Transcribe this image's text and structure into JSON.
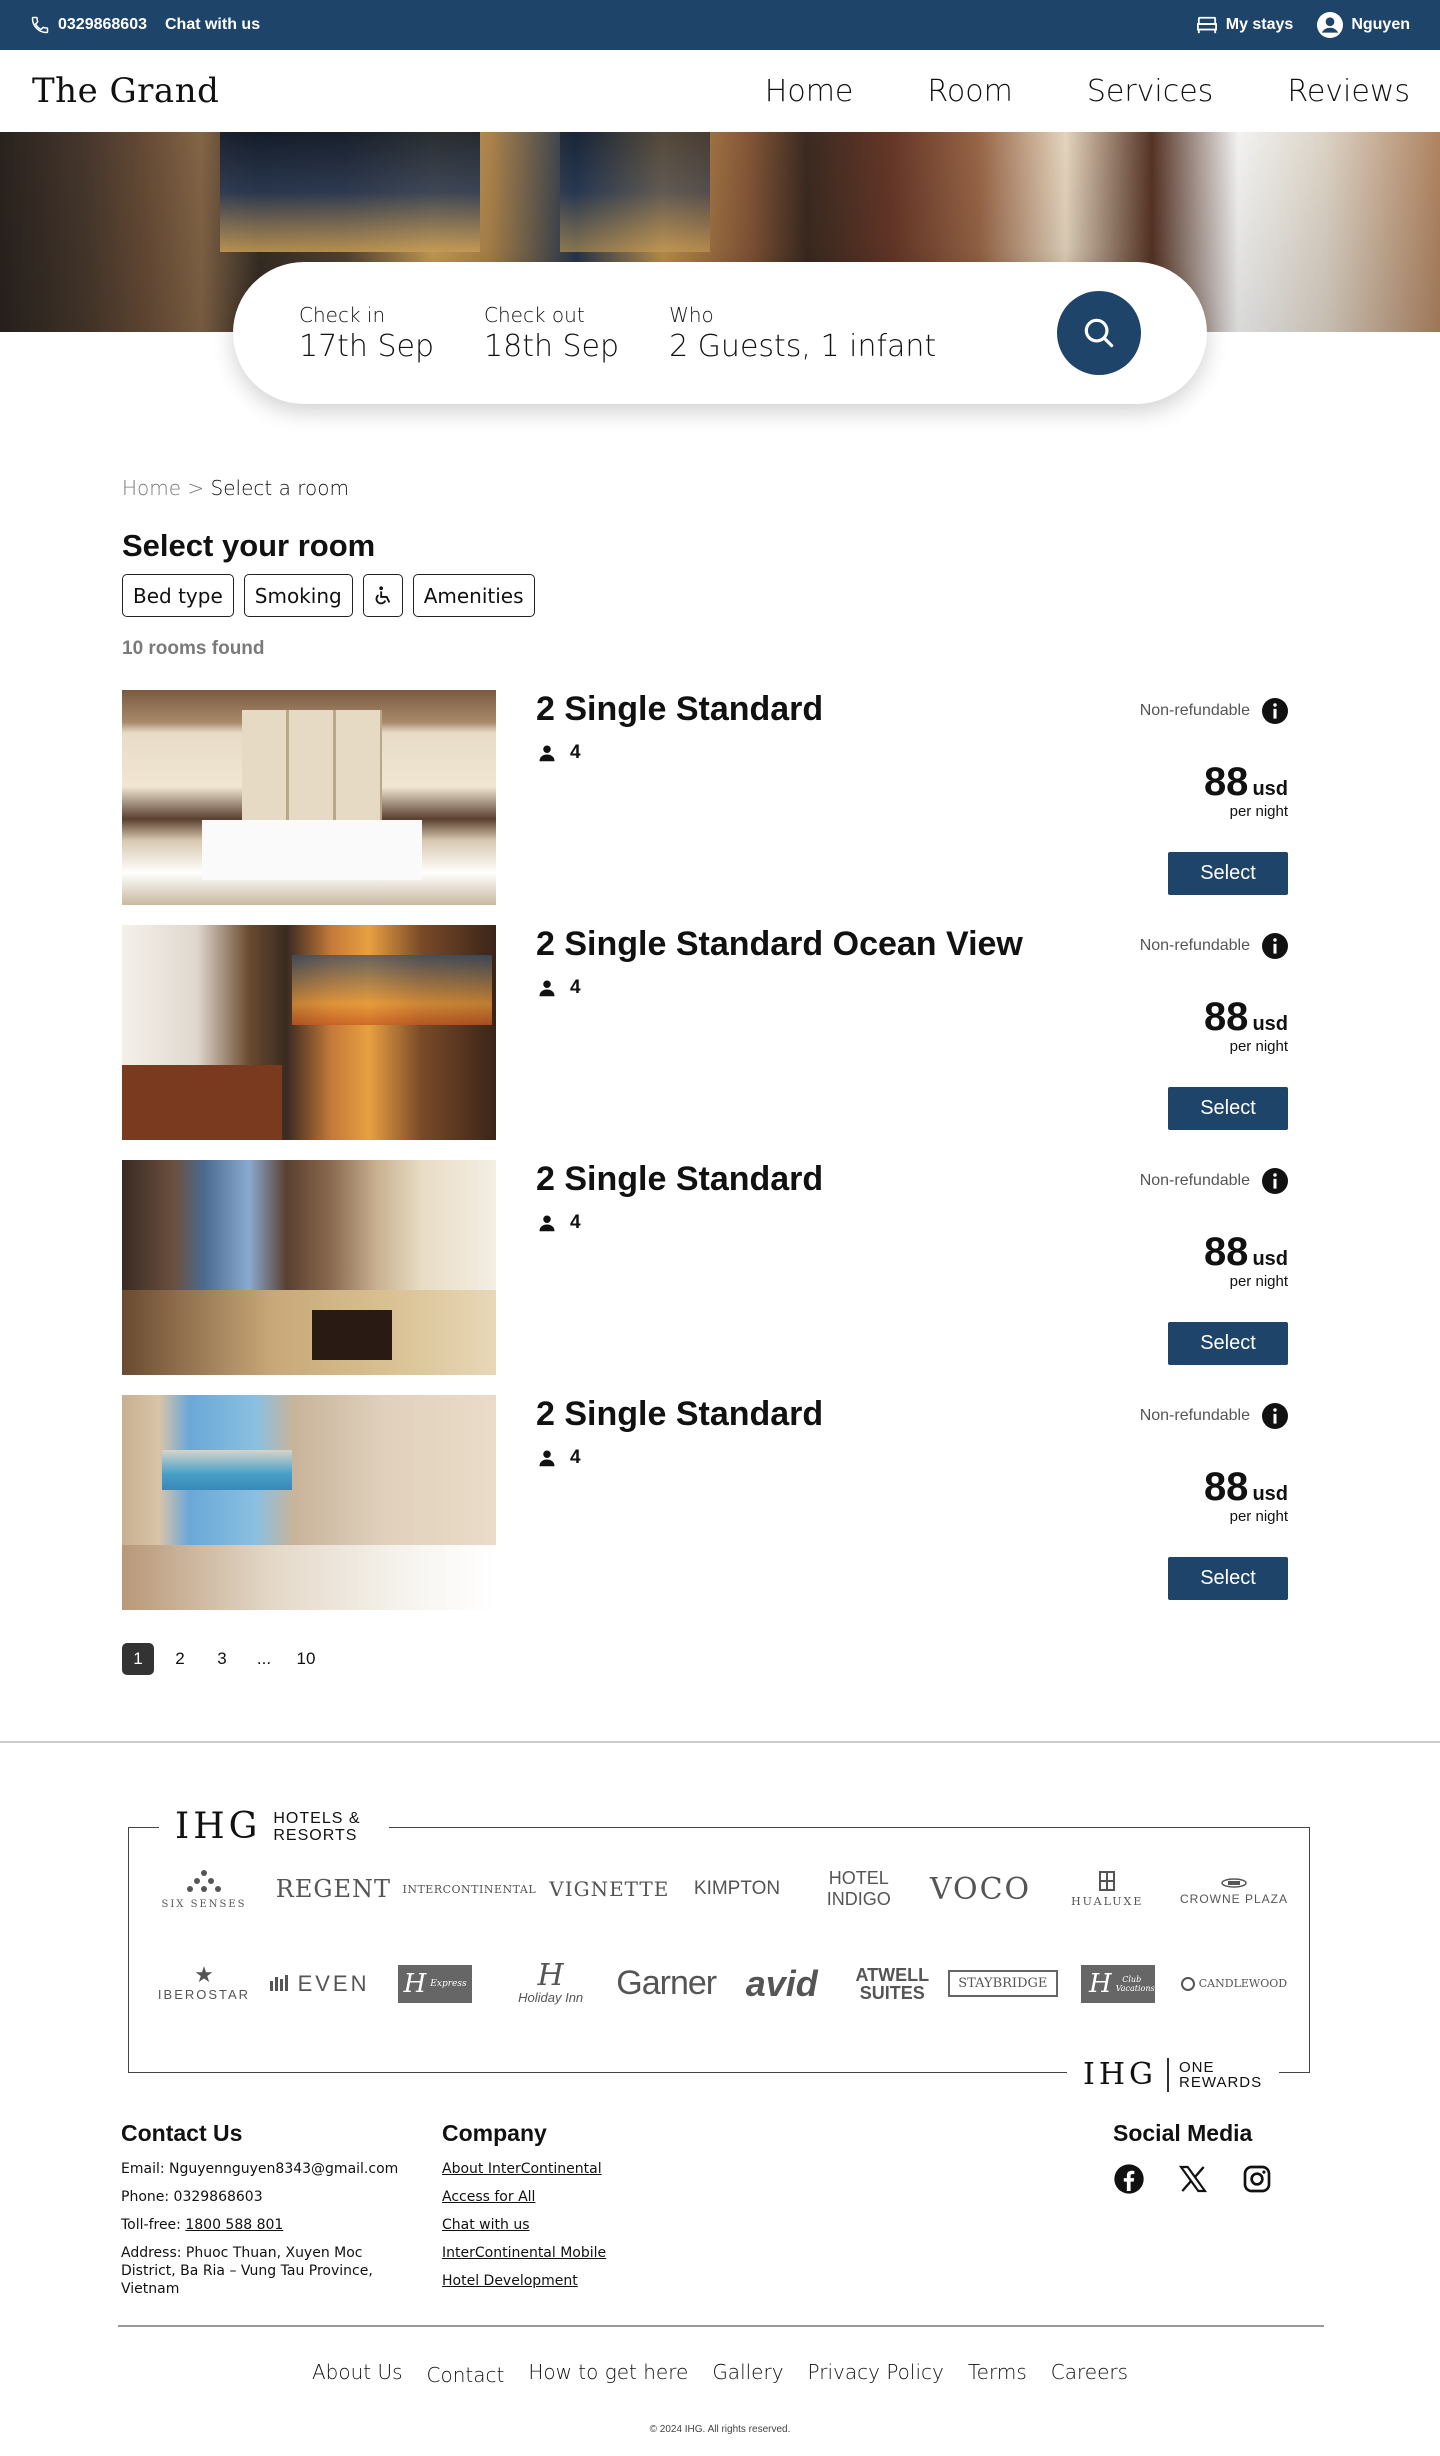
{
  "topbar": {
    "phone": "0329868603",
    "chat": "Chat with us",
    "my_stays": "My stays",
    "user": "Nguyen"
  },
  "nav": {
    "logo": "The Grand",
    "links": [
      "Home",
      "Room",
      "Services",
      "Reviews"
    ]
  },
  "search": {
    "check_in_label": "Check in",
    "check_in_value": "17th Sep",
    "check_out_label": "Check out",
    "check_out_value": "18th Sep",
    "who_label": "Who",
    "who_value": "2 Guests, 1 infant"
  },
  "breadcrumb": {
    "home": "Home",
    "sep": " > ",
    "current": "Select a room"
  },
  "main": {
    "title": "Select your room",
    "filters": [
      "Bed type",
      "Smoking",
      "Amenities"
    ],
    "rooms_found": "10 rooms found"
  },
  "rooms": [
    {
      "name": "2 Single Standard",
      "guests": "4",
      "policy": "Non-refundable",
      "price": "88",
      "currency": "usd",
      "per": "per night",
      "select": "Select"
    },
    {
      "name": "2 Single Standard Ocean View",
      "guests": "4",
      "policy": "Non-refundable",
      "price": "88",
      "currency": "usd",
      "per": "per night",
      "select": "Select"
    },
    {
      "name": "2 Single Standard",
      "guests": "4",
      "policy": "Non-refundable",
      "price": "88",
      "currency": "usd",
      "per": "per night",
      "select": "Select"
    },
    {
      "name": "2 Single Standard",
      "guests": "4",
      "policy": "Non-refundable",
      "price": "88",
      "currency": "usd",
      "per": "per night",
      "select": "Select"
    }
  ],
  "pagination": [
    "1",
    "2",
    "3",
    "...",
    "10"
  ],
  "brands": {
    "ihg": "IHG",
    "hotels_resorts": "HOTELS & RESORTS",
    "ihg_footer": "IHG",
    "one_rewards": "ONE REWARDS",
    "row1": [
      "SIX SENSES",
      "REGENT",
      "INTERCONTINENTAL",
      "VIGNETTE",
      "KIMPTON",
      "HOTEL INDIGO",
      "VOCO",
      "HUALUXE",
      "CROWNE PLAZA"
    ],
    "row2": [
      "IBEROSTAR",
      "EVEN",
      "Express",
      "Holiday Inn",
      "Garner",
      "avid",
      "ATWELL SUITES",
      "STAYBRIDGE",
      "Club Vacations",
      "CANDLEWOOD"
    ]
  },
  "footer": {
    "contact_title": "Contact Us",
    "email": "Email: Nguyennguyen8343@gmail.com",
    "phone": "Phone: 0329868603",
    "tollfree_label": "Toll-free: ",
    "tollfree": "1800 588 801",
    "address": "Address: Phuoc Thuan, Xuyen Moc District, Ba Ria – Vung Tau Province, Vietnam",
    "company_title": "Company",
    "company_links": [
      "About InterContinental",
      "Access for All",
      "Chat with us",
      "InterContinental Mobile",
      "Hotel Development"
    ],
    "social_title": "Social Media",
    "bottom_links": [
      "About Us",
      "Contact",
      "How to get here",
      "Gallery",
      "Privacy Policy",
      "Terms",
      "Careers"
    ],
    "copyright": "© 2024 IHG. All rights reserved."
  },
  "colors": {
    "primary": "#1e4469"
  }
}
